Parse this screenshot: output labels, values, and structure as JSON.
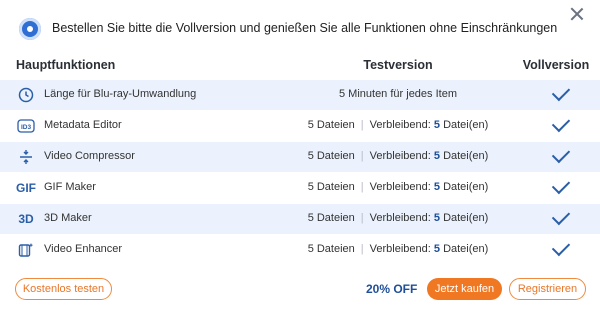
{
  "banner": {
    "text": "Bestellen Sie bitte die Vollversion und genießen Sie alle Funktionen ohne Einschränkungen"
  },
  "icons": {
    "logo": "disc-logo-icon",
    "close": "close-icon",
    "check": "checkmark-icon"
  },
  "table": {
    "headers": {
      "feature": "Hauptfunktionen",
      "trial": "Testversion",
      "full": "Vollversion"
    },
    "rows": [
      {
        "icon": "clock-icon",
        "name": "Länge für Blu-ray-Umwandlung",
        "trial_full": "5 Minuten für jedes Item"
      },
      {
        "icon": "id3-icon",
        "icon_text": "ID3",
        "name": "Metadata Editor",
        "trial_a": "5 Dateien",
        "trial_b_label": "Verbleibend:",
        "trial_b_value": "5",
        "trial_b_unit": "Datei(en)"
      },
      {
        "icon": "compress-icon",
        "name": "Video Compressor",
        "trial_a": "5 Dateien",
        "trial_b_label": "Verbleibend:",
        "trial_b_value": "5",
        "trial_b_unit": "Datei(en)"
      },
      {
        "icon": "gif-icon",
        "icon_text": "GIF",
        "name": "GIF Maker",
        "trial_a": "5 Dateien",
        "trial_b_label": "Verbleibend:",
        "trial_b_value": "5",
        "trial_b_unit": "Datei(en)"
      },
      {
        "icon": "3d-icon",
        "icon_text": "3D",
        "name": "3D Maker",
        "trial_a": "5 Dateien",
        "trial_b_label": "Verbleibend:",
        "trial_b_value": "5",
        "trial_b_unit": "Datei(en)"
      },
      {
        "icon": "enhance-icon",
        "name": "Video Enhancer",
        "trial_a": "5 Dateien",
        "trial_b_label": "Verbleibend:",
        "trial_b_value": "5",
        "trial_b_unit": "Datei(en)"
      }
    ]
  },
  "footer": {
    "free_label": "Kostenlos testen",
    "discount": "20% OFF",
    "buy_label": "Jetzt kaufen",
    "register_label": "Registrieren"
  },
  "colors": {
    "accent": "#f07822",
    "brand": "#2b5ea8",
    "row_stripe": "#ebf2fd"
  }
}
